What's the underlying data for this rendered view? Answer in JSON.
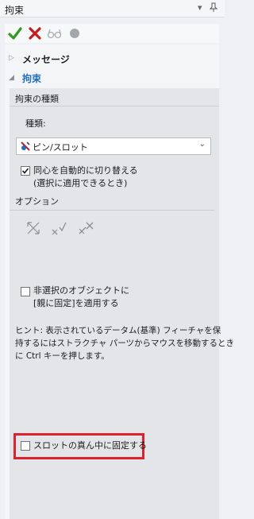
{
  "panel": {
    "title": "拘束"
  },
  "sections": {
    "message": "メッセージ",
    "constraint": "拘束"
  },
  "constraint_group": {
    "header": "拘束の種類",
    "type_label": "種類:",
    "type_value": "ピン/スロット",
    "auto_switch_line1": "同心を自動的に切り替える",
    "auto_switch_line2": "(選択に適用できるとき)",
    "auto_switch_checked": true
  },
  "options": {
    "header": "オプション",
    "fix_parent_line1": "非選択のオブジェクトに",
    "fix_parent_line2": "[親に固定]を適用する",
    "fix_parent_checked": false,
    "hint_line1": "ヒント: 表示されているデータム(基準) フィーチャを保",
    "hint_line2": "持するにはストラクチャ パーツからマウスを移動するとき",
    "hint_line3": "に Ctrl キーを押します。",
    "slot_center_label": "スロットの真ん中に固定する",
    "slot_center_checked": false
  },
  "colors": {
    "accent": "#1f6fc5",
    "check_green": "#2e9b1e",
    "cancel_red": "#c8191a",
    "highlight_red": "#e0202a"
  }
}
